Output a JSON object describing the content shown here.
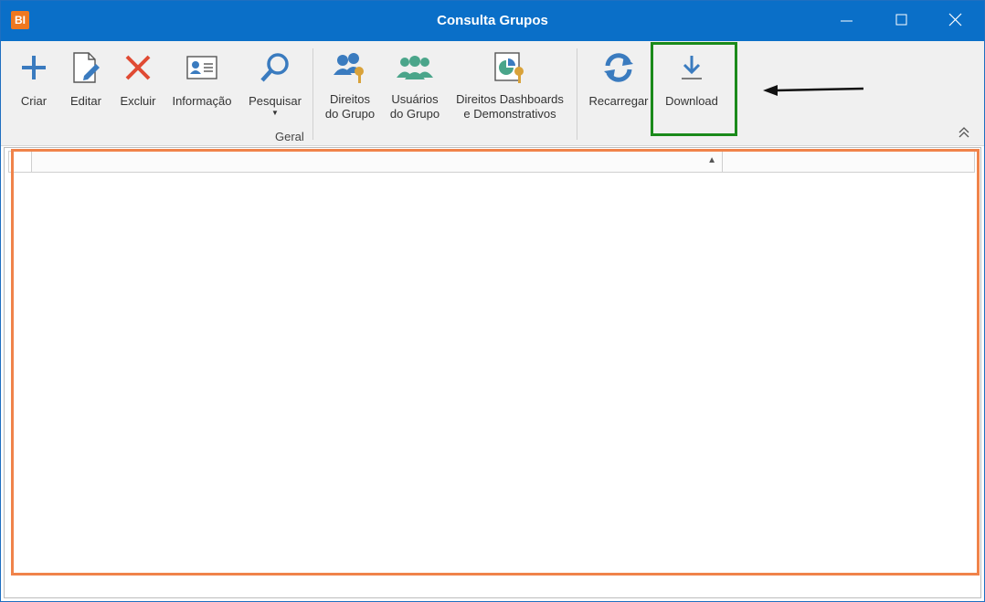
{
  "window": {
    "title": "Consulta Grupos",
    "app_icon_text": "BI"
  },
  "ribbon": {
    "buttons": [
      {
        "label": "Criar",
        "icon": "plus-icon"
      },
      {
        "label": "Editar",
        "icon": "edit-document-icon"
      },
      {
        "label": "Excluir",
        "icon": "delete-x-icon"
      },
      {
        "label": "Informação",
        "icon": "id-card-icon"
      },
      {
        "label": "Pesquisar",
        "icon": "search-icon"
      },
      {
        "label": "Direitos\ndo Grupo",
        "icon": "group-key-icon"
      },
      {
        "label": "Usuários\ndo Grupo",
        "icon": "group-users-icon"
      },
      {
        "label": "Direitos Dashboards\ne Demonstrativos",
        "icon": "dashboard-key-icon"
      },
      {
        "label": "Recarregar",
        "icon": "refresh-icon"
      },
      {
        "label": "Download",
        "icon": "download-icon"
      }
    ],
    "group_label": "Geral"
  },
  "grid": {
    "columns": [
      "",
      ""
    ],
    "sort": "ascending",
    "rows": []
  },
  "colors": {
    "titlebar": "#0a6fc8",
    "highlight_orange": "#f0834a",
    "highlight_green": "#1a8a1a",
    "icon_blue": "#3a7bbf",
    "icon_red": "#e04a33"
  }
}
